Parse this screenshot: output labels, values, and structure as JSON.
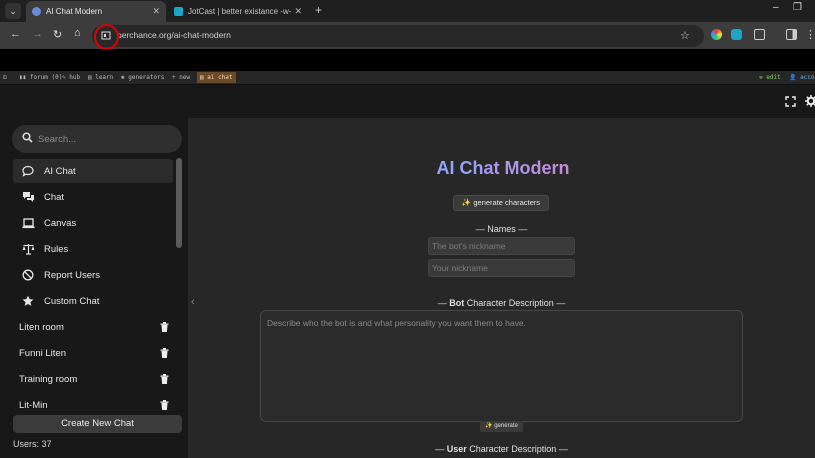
{
  "browser": {
    "tabs": [
      {
        "label": "AI Chat Modern",
        "active": true
      },
      {
        "label": "JotCast | better existance -w- |",
        "active": false
      }
    ],
    "new_tab": "+",
    "url": "perchance.org/ai-chat-modern"
  },
  "perchance_bar": {
    "items": [
      "forum (0)",
      "hub",
      "learn",
      "generators",
      "new",
      "ai chat"
    ],
    "right_items": [
      "edit",
      "account"
    ]
  },
  "sidebar": {
    "search_placeholder": "Search...",
    "nav_items": [
      {
        "label": "AI Chat",
        "icon": "speech-bubble-icon"
      },
      {
        "label": "Chat",
        "icon": "chat-bubbles-icon"
      },
      {
        "label": "Canvas",
        "icon": "laptop-icon"
      },
      {
        "label": "Rules",
        "icon": "scales-icon"
      },
      {
        "label": "Report Users",
        "icon": "block-icon"
      },
      {
        "label": "Custom Chat",
        "icon": "star-icon"
      }
    ],
    "rooms": [
      {
        "label": "Liten room"
      },
      {
        "label": "Funni Liten"
      },
      {
        "label": "Training room"
      },
      {
        "label": "Lit-Min"
      }
    ],
    "create_button": "Create New Chat",
    "users_label": "Users: 37"
  },
  "main": {
    "title": "AI Chat Modern",
    "generate_characters": "✨ generate characters",
    "names_label": "— Names —",
    "bot_nickname_placeholder": "The bot's nickname",
    "your_nickname_placeholder": "Your nickname",
    "bot_desc_prefix": "— ",
    "bot_desc_bold": "Bot",
    "bot_desc_suffix": " Character Description —",
    "bot_desc_placeholder": "Describe who the bot is and what personality you want them to have.",
    "generate_small": "✨ generate",
    "user_desc_prefix": "— ",
    "user_desc_bold": "User",
    "user_desc_suffix": " Character Description —"
  },
  "colors": {
    "accent_gradient_start": "#8fa6ff",
    "accent_gradient_end": "#c58ad9",
    "annotation_red": "#e00000"
  }
}
